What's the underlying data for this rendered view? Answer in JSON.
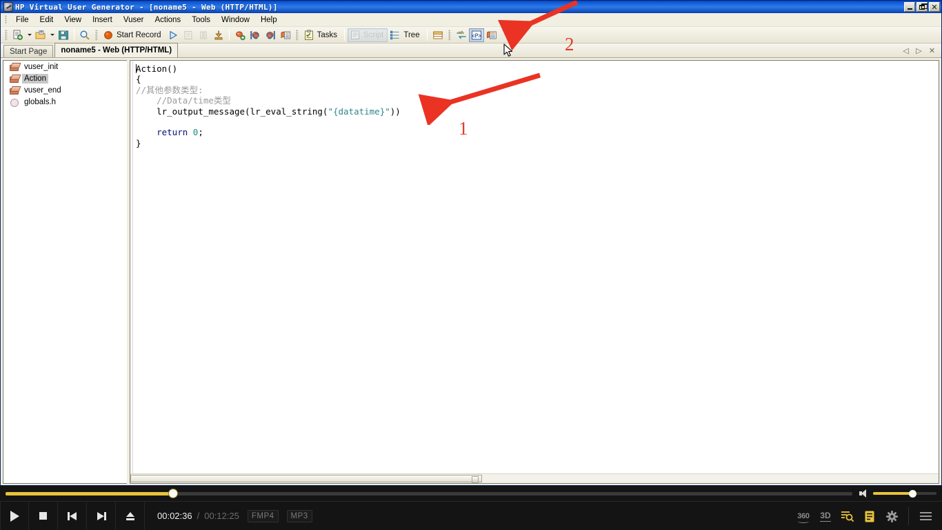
{
  "window": {
    "title": "HP Virtual User Generator - [noname5 - Web (HTTP/HTML)]",
    "icon": "app-icon",
    "controls": {
      "minimize": "–",
      "maximize": "❐",
      "close": "✕"
    }
  },
  "menubar": {
    "items": [
      {
        "label": "File"
      },
      {
        "label": "Edit"
      },
      {
        "label": "View"
      },
      {
        "label": "Insert"
      },
      {
        "label": "Vuser"
      },
      {
        "label": "Actions"
      },
      {
        "label": "Tools"
      },
      {
        "label": "Window"
      },
      {
        "label": "Help"
      }
    ]
  },
  "toolbar": {
    "new_script": "new-script-icon",
    "open": "open-folder-icon",
    "save": "save-disk-icon",
    "find": "find-magnifier-icon",
    "start_record_label": "Start Record",
    "run_label": "run-icon",
    "pause_label": "pause-icon",
    "stop_label": "stop-icon",
    "compile_label": "compile-icon",
    "tasks_label": "Tasks",
    "script_label": "Script",
    "tree_label": "Tree",
    "split_view": "split-view-icon",
    "param_list": "parameter-list-icon",
    "param_insert": "insert-parameter-icon",
    "snapshot": "snapshot-icon"
  },
  "tabs": {
    "items": [
      {
        "label": "Start Page",
        "active": false
      },
      {
        "label": "noname5 - Web (HTTP/HTML)",
        "active": true
      }
    ],
    "nav": {
      "prev": "◁",
      "next": "▷",
      "close": "✕"
    }
  },
  "tree": {
    "items": [
      {
        "label": "vuser_init",
        "icon": "action-block-icon",
        "selected": false
      },
      {
        "label": "Action",
        "icon": "action-block-icon",
        "selected": true
      },
      {
        "label": "vuser_end",
        "icon": "action-block-icon",
        "selected": false
      },
      {
        "label": "globals.h",
        "icon": "header-file-icon",
        "selected": false
      }
    ]
  },
  "editor": {
    "lines": [
      [
        {
          "t": "Action()",
          "c": "plain"
        }
      ],
      [
        {
          "t": "{",
          "c": "plain"
        }
      ],
      [
        {
          "t": "//其他参数类型:",
          "c": "cm"
        }
      ],
      [
        {
          "t": "    //Data/time类型",
          "c": "cm"
        }
      ],
      [
        {
          "t": "    lr_output_message(lr_eval_string(",
          "c": "plain"
        },
        {
          "t": "\"{datatime}\"",
          "c": "str"
        },
        {
          "t": "))",
          "c": "plain"
        }
      ],
      [
        {
          "t": "",
          "c": "plain"
        }
      ],
      [
        {
          "t": "    ",
          "c": "plain"
        },
        {
          "t": "return",
          "c": "kw"
        },
        {
          "t": " ",
          "c": "plain"
        },
        {
          "t": "0",
          "c": "num"
        },
        {
          "t": ";",
          "c": "plain"
        }
      ],
      [
        {
          "t": "}",
          "c": "plain"
        }
      ]
    ]
  },
  "annotations": {
    "arrow1_number": "1",
    "arrow2_number": "2",
    "color": "#e23b2e"
  },
  "player": {
    "seek": {
      "percent": 19.8
    },
    "volume": {
      "percent": 62
    },
    "buttons": {
      "play": "play-icon",
      "stop": "stop-icon",
      "previous": "previous-track-icon",
      "next": "next-track-icon",
      "eject": "eject-icon"
    },
    "time_current": "00:02:36",
    "time_separator": "/",
    "time_total": "00:12:25",
    "badges": [
      "FMP4",
      "MP3"
    ],
    "right_controls": [
      {
        "name": "360-button",
        "label": "360"
      },
      {
        "name": "3d-button",
        "label": "3D"
      },
      {
        "name": "search-button",
        "label": "search-zoom-icon"
      },
      {
        "name": "playlist-button",
        "label": "playlist-icon"
      },
      {
        "name": "settings-button",
        "label": "gear-icon"
      },
      {
        "name": "menu-button",
        "label": "hamburger-icon"
      }
    ]
  }
}
